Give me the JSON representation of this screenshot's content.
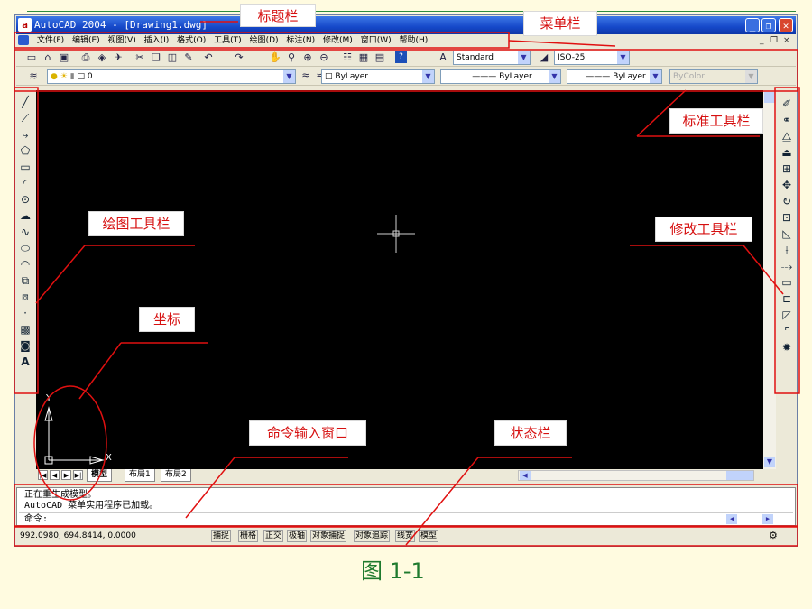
{
  "window": {
    "title": "AutoCAD 2004 - [Drawing1.dwg]",
    "app_icon_letter": "a",
    "controls": {
      "minimize": "_",
      "restore": "❐",
      "close": "✕"
    }
  },
  "menubar": {
    "items": [
      "文件(F)",
      "编辑(E)",
      "视图(V)",
      "插入(I)",
      "格式(O)",
      "工具(T)",
      "绘图(D)",
      "标注(N)",
      "修改(M)",
      "窗口(W)",
      "帮助(H)"
    ],
    "mdi_minimize": "_",
    "mdi_restore": "❐",
    "mdi_close": "×"
  },
  "standard_toolbar": {
    "text_style": "Standard",
    "dim_style": "ISO-25"
  },
  "properties_toolbar": {
    "layer": "0",
    "color": "ByLayer",
    "linetype": "ByLayer",
    "lineweight": "ByLayer",
    "plot_style": "ByColor"
  },
  "draw_toolbar_text_tool": "A",
  "ucs": {
    "y_label": "Y",
    "x_label": "X"
  },
  "layout_tabs": [
    "模型",
    "布局1",
    "布局2"
  ],
  "command_window": {
    "lines": [
      "正在重生成模型。",
      "AutoCAD 菜单实用程序已加载。"
    ],
    "prompt": "命令:"
  },
  "statusbar": {
    "coords": "992.0980,  694.8414, 0.0000",
    "buttons": [
      "捕捉",
      "栅格",
      "正交",
      "极轴",
      "对象捕捉",
      "对象追踪",
      "线宽",
      "模型"
    ]
  },
  "annotations": {
    "title_bar": "标题栏",
    "menu_bar": "菜单栏",
    "standard_toolbar": "标准工具栏",
    "draw_toolbar": "绘图工具栏",
    "modify_toolbar": "修改工具栏",
    "coordinates": "坐标",
    "command_window": "命令输入窗口",
    "status_bar": "状态栏"
  },
  "caption": "图 1-1",
  "colors": {
    "slide_bg": "#fffbe0",
    "annotation": "#d61010",
    "caption": "#1f7a2e",
    "canvas": "#000000",
    "titlebar": "#1548c9"
  }
}
